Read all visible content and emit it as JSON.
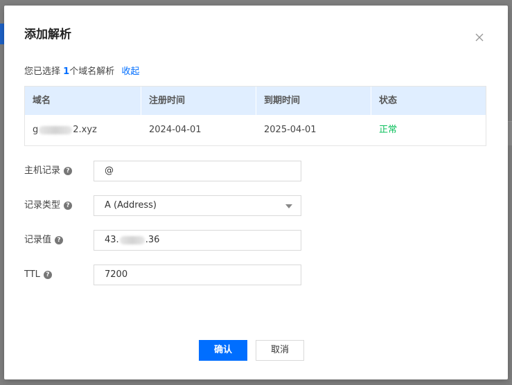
{
  "dialog": {
    "title": "添加解析",
    "close_icon": "close-icon"
  },
  "selection": {
    "prefix": "您已选择",
    "count": "1",
    "suffix": "个域名解析",
    "collapse_label": "收起"
  },
  "table": {
    "columns": [
      "域名",
      "注册时间",
      "到期时间",
      "状态"
    ],
    "rows": [
      {
        "domain_start": "g",
        "domain_end": "2.xyz",
        "registered": "2024-04-01",
        "expires": "2025-04-01",
        "status": "正常"
      }
    ]
  },
  "form": {
    "host_record": {
      "label": "主机记录",
      "value": "@"
    },
    "record_type": {
      "label": "记录类型",
      "value": "A (Address)"
    },
    "record_value": {
      "label": "记录值",
      "value_start": "43.",
      "value_end": ".36"
    },
    "ttl": {
      "label": "TTL",
      "value": "7200"
    },
    "help_glyph": "?"
  },
  "buttons": {
    "confirm": "确认",
    "cancel": "取消"
  },
  "colors": {
    "primary": "#006eff",
    "status_ok": "#0abf5b",
    "table_header_bg": "#e0eeff"
  }
}
